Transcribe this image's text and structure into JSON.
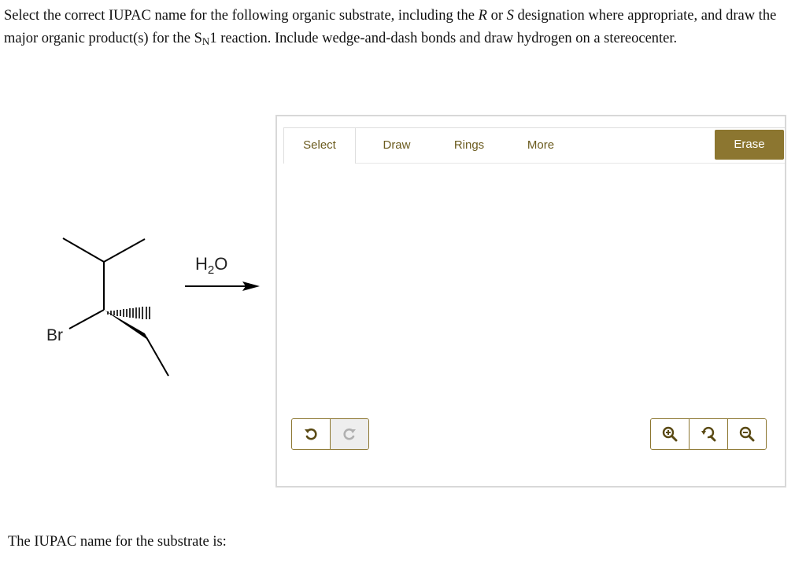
{
  "question": {
    "part1": "Select the correct IUPAC name for the following organic substrate, including the ",
    "r": "R",
    "or": " or ",
    "s": "S",
    "part2": " designation where appropriate, and draw the major organic product(s) for the S",
    "sn_sub": "N",
    "part3": "1 reaction. Include wedge-and-dash bonds and draw hydrogen on a stereocenter."
  },
  "reaction": {
    "leaving_group": "Br",
    "reagent_main": "H",
    "reagent_sub": "2",
    "reagent_end": "O"
  },
  "toolbar": {
    "tabs": [
      "Select",
      "Draw",
      "Rings",
      "More"
    ],
    "erase": "Erase"
  },
  "icons": {
    "undo": "undo-icon",
    "redo": "redo-icon",
    "zoom_in": "zoom-in-icon",
    "zoom_reset": "zoom-reset-icon",
    "zoom_out": "zoom-out-icon"
  },
  "colors": {
    "accent": "#8c7630",
    "tab_text": "#6b5b1e"
  },
  "answer": {
    "label": "The IUPAC name for the substrate is:"
  }
}
